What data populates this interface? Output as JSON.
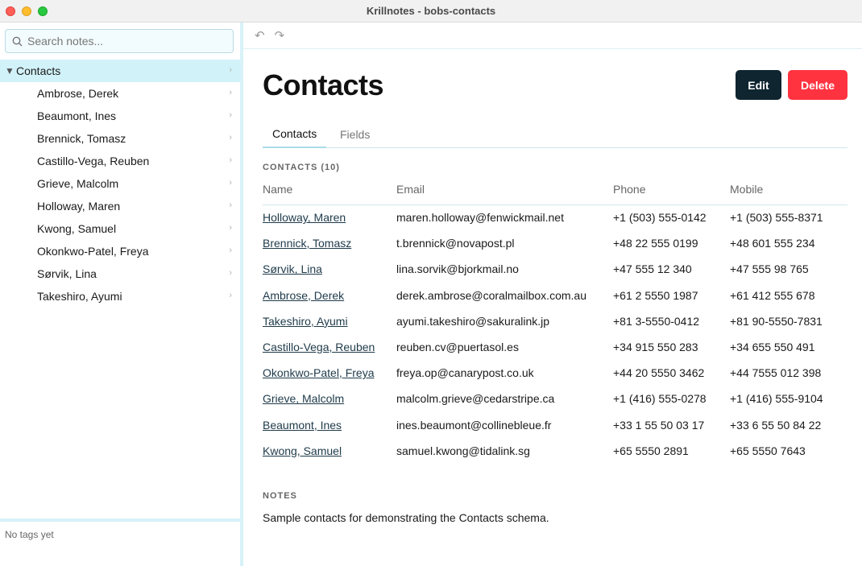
{
  "window": {
    "title": "Krillnotes - bobs-contacts"
  },
  "sidebar": {
    "search_placeholder": "Search notes...",
    "root": {
      "label": "Contacts",
      "caret": "▼",
      "chevron": "›"
    },
    "items": [
      {
        "label": "Ambrose, Derek"
      },
      {
        "label": "Beaumont, Ines"
      },
      {
        "label": "Brennick, Tomasz"
      },
      {
        "label": "Castillo-Vega, Reuben"
      },
      {
        "label": "Grieve, Malcolm"
      },
      {
        "label": "Holloway, Maren"
      },
      {
        "label": "Kwong, Samuel"
      },
      {
        "label": "Okonkwo-Patel, Freya"
      },
      {
        "label": "Sørvik, Lina"
      },
      {
        "label": "Takeshiro, Ayumi"
      }
    ],
    "chevron": "›",
    "tags_text": "No tags yet"
  },
  "toolbar": {
    "undo_icon": "↶",
    "redo_icon": "↷"
  },
  "main": {
    "title": "Contacts",
    "edit_label": "Edit",
    "delete_label": "Delete",
    "tabs": [
      {
        "label": "Contacts"
      },
      {
        "label": "Fields"
      }
    ],
    "contacts_heading": "CONTACTS (10)",
    "columns": [
      "Name",
      "Email",
      "Phone",
      "Mobile"
    ],
    "rows": [
      {
        "name": "Holloway, Maren",
        "email": "maren.holloway@fenwickmail.net",
        "phone": "+1 (503) 555-0142",
        "mobile": "+1 (503) 555-8371"
      },
      {
        "name": "Brennick, Tomasz",
        "email": "t.brennick@novapost.pl",
        "phone": "+48 22 555 0199",
        "mobile": "+48 601 555 234"
      },
      {
        "name": "Sørvik, Lina",
        "email": "lina.sorvik@bjorkmail.no",
        "phone": "+47 555 12 340",
        "mobile": "+47 555 98 765"
      },
      {
        "name": "Ambrose, Derek",
        "email": "derek.ambrose@coralmailbox.com.au",
        "phone": "+61 2 5550 1987",
        "mobile": "+61 412 555 678"
      },
      {
        "name": "Takeshiro, Ayumi",
        "email": "ayumi.takeshiro@sakuralink.jp",
        "phone": "+81 3-5550-0412",
        "mobile": "+81 90-5550-7831"
      },
      {
        "name": "Castillo-Vega, Reuben",
        "email": "reuben.cv@puertasol.es",
        "phone": "+34 915 550 283",
        "mobile": "+34 655 550 491"
      },
      {
        "name": "Okonkwo-Patel, Freya",
        "email": "freya.op@canarypost.co.uk",
        "phone": "+44 20 5550 3462",
        "mobile": "+44 7555 012 398"
      },
      {
        "name": "Grieve, Malcolm",
        "email": "malcolm.grieve@cedarstripe.ca",
        "phone": "+1 (416) 555-0278",
        "mobile": "+1 (416) 555-9104"
      },
      {
        "name": "Beaumont, Ines",
        "email": "ines.beaumont@collinebleue.fr",
        "phone": "+33 1 55 50 03 17",
        "mobile": "+33 6 55 50 84 22"
      },
      {
        "name": "Kwong, Samuel",
        "email": "samuel.kwong@tidalink.sg",
        "phone": "+65 5550 2891",
        "mobile": "+65 5550 7643"
      }
    ],
    "notes_heading": "NOTES",
    "notes_text": "Sample contacts for demonstrating the Contacts schema."
  },
  "colors": {
    "accent": "#d2f2f9",
    "edit_button": "#0f2530",
    "delete_button": "#ff3340"
  }
}
